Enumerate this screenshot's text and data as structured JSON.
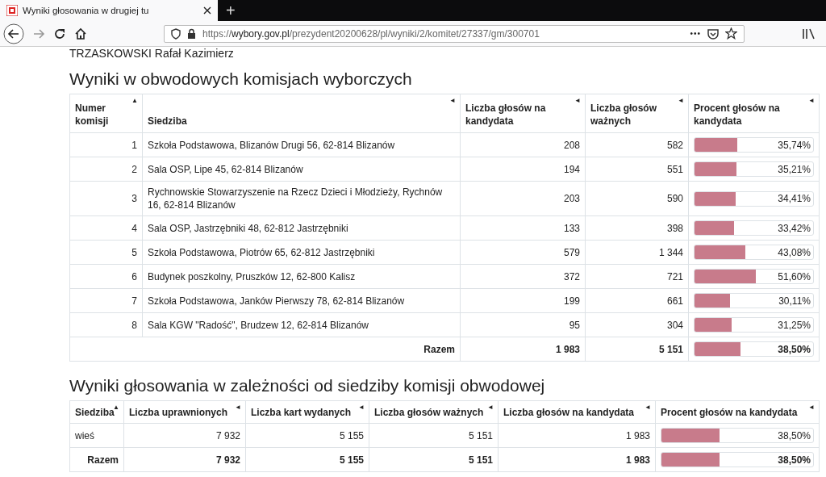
{
  "browser": {
    "tab_title": "Wyniki głosowania w drugiej tu",
    "new_tab": "+",
    "url_prefix": "https://",
    "url_domain": "wybory.gov.pl",
    "url_path": "/prezydent20200628/pl/wyniki/2/komitet/27337/gm/300701",
    "more": "•••"
  },
  "candidate": "TRZASKOWSKI Rafał Kazimierz",
  "section1": {
    "heading": "Wyniki w obwodowych komisjach wyborczych",
    "columns": [
      {
        "label": "Numer komisji",
        "sort": "▲"
      },
      {
        "label": "Siedziba",
        "sort": "◄"
      },
      {
        "label": "Liczba głosów na kandydata",
        "sort": "◄"
      },
      {
        "label": "Liczba głosów ważnych",
        "sort": "◄"
      },
      {
        "label": "Procent głosów na kandydata",
        "sort": "◄"
      }
    ],
    "rows": [
      {
        "number": "1",
        "seat": "Szkoła Podstawowa, Blizanów Drugi 56, 62-814 Blizanów",
        "votes": "208",
        "valid": "582",
        "percent": "35,74%",
        "level": 0.3574
      },
      {
        "number": "2",
        "seat": "Sala OSP, Lipe 45, 62-814 Blizanów",
        "votes": "194",
        "valid": "551",
        "percent": "35,21%",
        "level": 0.3521
      },
      {
        "number": "3",
        "seat": "Rychnowskie Stowarzyszenie na Rzecz Dzieci i Młodzieży, Rychnów 16, 62-814 Blizanów",
        "votes": "203",
        "valid": "590",
        "percent": "34,41%",
        "level": 0.3441
      },
      {
        "number": "4",
        "seat": "Sala OSP, Jastrzębniki 48, 62-812 Jastrzębniki",
        "votes": "133",
        "valid": "398",
        "percent": "33,42%",
        "level": 0.3342
      },
      {
        "number": "5",
        "seat": "Szkoła Podstawowa, Piotrów 65, 62-812 Jastrzębniki",
        "votes": "579",
        "valid": "1 344",
        "percent": "43,08%",
        "level": 0.4308
      },
      {
        "number": "6",
        "seat": "Budynek poszkolny, Pruszków 12, 62-800 Kalisz",
        "votes": "372",
        "valid": "721",
        "percent": "51,60%",
        "level": 0.516
      },
      {
        "number": "7",
        "seat": "Szkoła Podstawowa, Janków Pierwszy 78, 62-814 Blizanów",
        "votes": "199",
        "valid": "661",
        "percent": "30,11%",
        "level": 0.3011
      },
      {
        "number": "8",
        "seat": "Sala KGW \"Radość\", Brudzew 12, 62-814 Blizanów",
        "votes": "95",
        "valid": "304",
        "percent": "31,25%",
        "level": 0.3125
      }
    ],
    "total": {
      "label": "Razem",
      "votes": "1 983",
      "valid": "5 151",
      "percent": "38,50%",
      "level": 0.385
    }
  },
  "section2": {
    "heading": "Wyniki głosowania w zależności od siedziby komisji obwodowej",
    "columns": [
      {
        "label": "Siedziba",
        "sort": "▲"
      },
      {
        "label": "Liczba uprawnionych",
        "sort": "◄"
      },
      {
        "label": "Liczba kart wydanych",
        "sort": "◄"
      },
      {
        "label": "Liczba głosów ważnych",
        "sort": "◄"
      },
      {
        "label": "Liczba głosów na kandydata",
        "sort": "◄"
      },
      {
        "label": "Procent głosów na kandydata",
        "sort": "◄"
      }
    ],
    "rows": [
      {
        "kind": "row",
        "seat": "wieś",
        "eligible": "7 932",
        "cards": "5 155",
        "valid": "5 151",
        "votes": "1 983",
        "percent": "38,50%",
        "level": 0.385
      },
      {
        "kind": "total",
        "seat": "Razem",
        "eligible": "7 932",
        "cards": "5 155",
        "valid": "5 151",
        "votes": "1 983",
        "percent": "38,50%",
        "level": 0.385
      }
    ]
  }
}
